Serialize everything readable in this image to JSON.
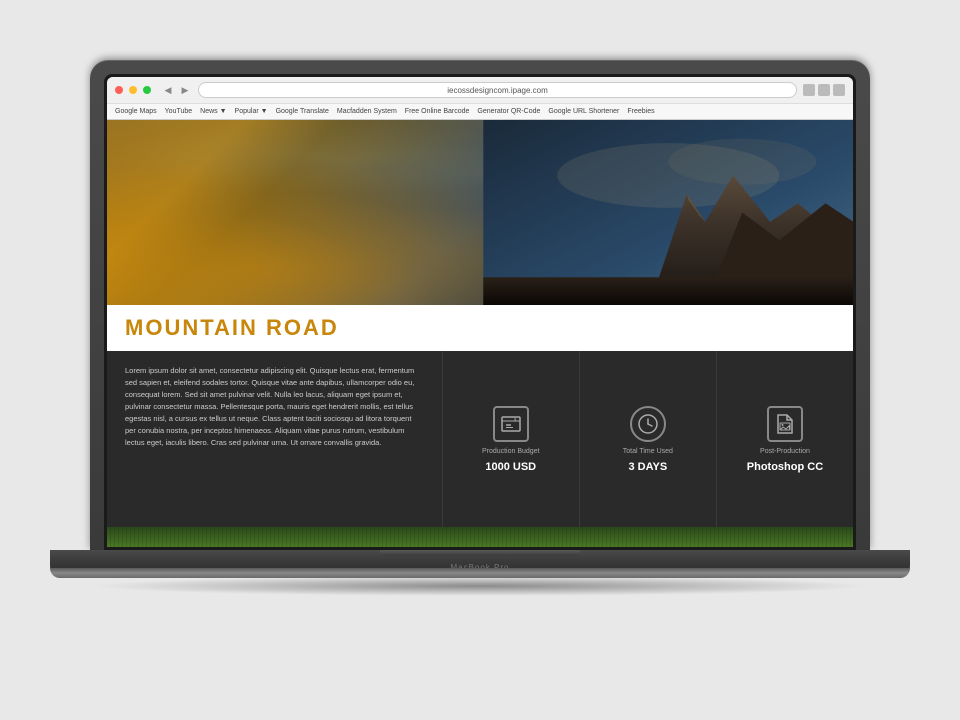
{
  "browser": {
    "url": "iecossdesigncom.ipage.com",
    "buttons": {
      "close": "close",
      "minimize": "minimize",
      "maximize": "maximize"
    },
    "bookmarks": [
      "Google Maps",
      "YouTube",
      "News ▼",
      "Popular ▼",
      "Google Translate",
      "Macfadden System",
      "Free Online Barcode",
      "Generator QR-Code",
      "Google URL Shortener",
      "Freebies"
    ]
  },
  "hero": {
    "title": "MOUNTAIN ROAD",
    "title_color": "#c8870a"
  },
  "description": {
    "text": "Lorem ipsum dolor sit amet, consectetur adipiscing elit. Quisque lectus erat, fermentum sed sapien et, eleifend sodales tortor. Quisque vitae ante dapibus, ullamcorper odio eu, consequat lorem. Sed sit amet pulvinar velit. Nulla leo lacus, aliquam eget ipsum et, pulvinar consectetur massa. Pellentesque porta, mauris eget hendrerit mollis, est tellus egestas nisl, a cursus ex tellus ut neque. Class aptent taciti sociosqu ad litora torquent per conubia nostra, per inceptos himenaeos. Aliquam vitae purus rutrum, vestibulum lectus eget, iaculis libero. Cras sed pulvinar urna. Ut ornare convallis gravida."
  },
  "stats": [
    {
      "icon_type": "budget",
      "label": "Production Budget",
      "value": "1000 USD"
    },
    {
      "icon_type": "clock",
      "label": "Total Time Used",
      "value": "3 DAYS"
    },
    {
      "icon_type": "file",
      "label": "Post-Production",
      "value": "Photoshop CC"
    }
  ],
  "macbook_label": "MacBook Pro"
}
